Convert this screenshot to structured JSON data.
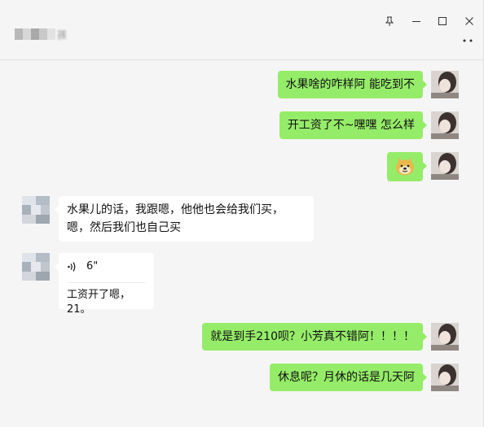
{
  "title_bar": {
    "contact_name_tail": "孩",
    "pin_icon": "pin-icon",
    "minimize_icon": "minimize-icon",
    "maximize_icon": "maximize-icon",
    "close_icon": "close-icon",
    "more_icon": "more-icon"
  },
  "messages": [
    {
      "side": "right",
      "text": "水果啥的咋样阿 能吃到不"
    },
    {
      "side": "right",
      "text": "开工资了不~嘿嘿 怎么样"
    },
    {
      "side": "right",
      "type": "emoji",
      "emoji_name": "doge-emoji"
    },
    {
      "side": "left",
      "text": "水果儿的话，我跟嗯，他他也会给我们买，嗯，然后我们也自己买"
    },
    {
      "side": "left",
      "type": "voice",
      "duration": "6\"",
      "transcript": "工资开了嗯，21。"
    },
    {
      "side": "right",
      "text": "就是到手210呗？小芳真不错阿！！！！"
    },
    {
      "side": "right",
      "text": "休息呢？月休的话是几天阿"
    }
  ]
}
